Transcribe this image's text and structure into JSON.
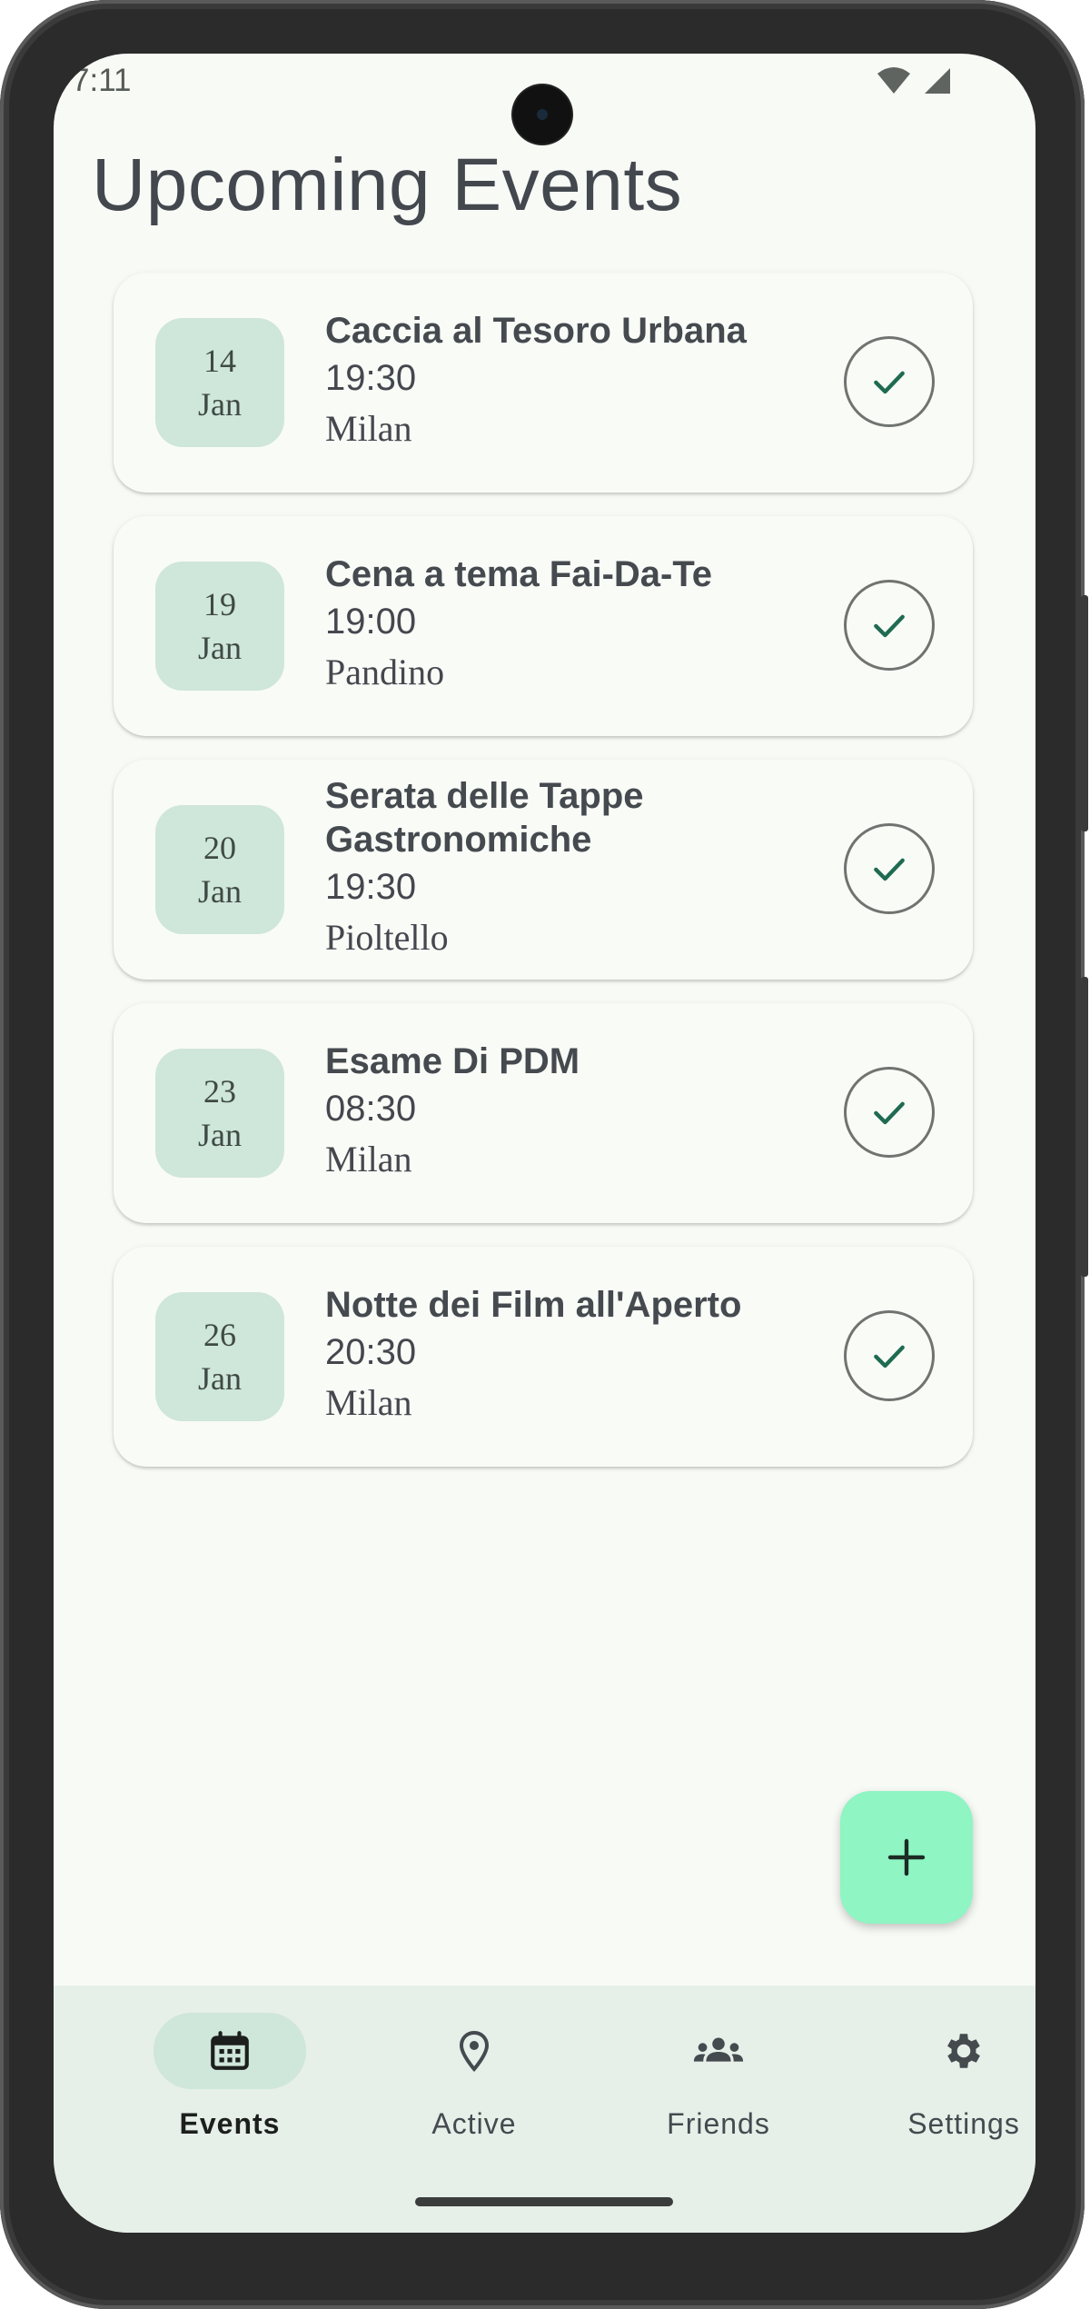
{
  "status_bar": {
    "time": "7:11",
    "wifi_icon": "wifi-icon",
    "signal_icon": "signal-icon"
  },
  "header": {
    "title": "Upcoming Events"
  },
  "events": [
    {
      "day": "14",
      "month": "Jan",
      "title": "Caccia al Tesoro Urbana",
      "time": "19:30",
      "place": "Milan"
    },
    {
      "day": "19",
      "month": "Jan",
      "title": "Cena a tema Fai-Da-Te",
      "time": "19:00",
      "place": "Pandino"
    },
    {
      "day": "20",
      "month": "Jan",
      "title": "Serata delle Tappe Gastronomiche",
      "time": "19:30",
      "place": "Pioltello"
    },
    {
      "day": "23",
      "month": "Jan",
      "title": "Esame Di PDM",
      "time": "08:30",
      "place": "Milan"
    },
    {
      "day": "26",
      "month": "Jan",
      "title": "Notte dei Film all'Aperto",
      "time": "20:30",
      "place": "Milan"
    }
  ],
  "fab": {
    "icon": "add-icon"
  },
  "bottom_nav": {
    "items": [
      {
        "label": "Events",
        "icon": "calendar-icon",
        "active": true
      },
      {
        "label": "Active",
        "icon": "location-pin-icon",
        "active": false
      },
      {
        "label": "Friends",
        "icon": "group-icon",
        "active": false
      },
      {
        "label": "Settings",
        "icon": "gear-icon",
        "active": false
      }
    ]
  },
  "colors": {
    "background": "#f8faf6",
    "accent_container": "#cfe6da",
    "fab": "#8ef5c3",
    "check": "#1f6b52",
    "nav_bar": "#e6efe8"
  }
}
